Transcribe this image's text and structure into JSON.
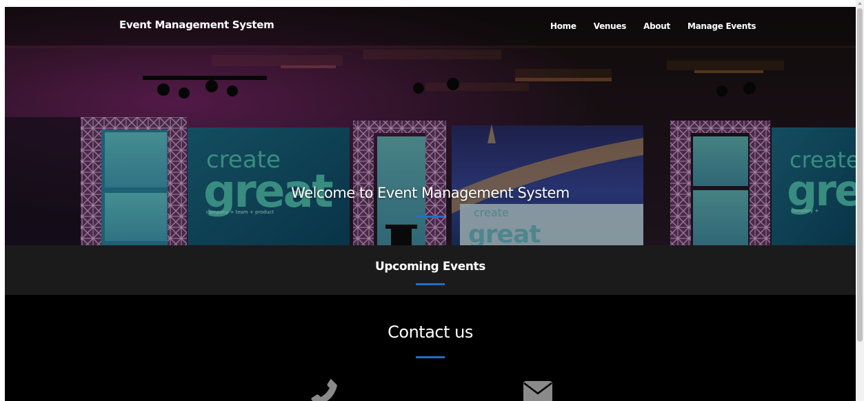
{
  "navbar": {
    "brand": "Event Management System",
    "links": [
      "Home",
      "Venues",
      "About",
      "Manage Events"
    ]
  },
  "hero": {
    "title": "Welcome to Event Management System",
    "background_text": {
      "left_small": "create",
      "left_big": "great",
      "left_tagline": "company + team + product",
      "center_small": "create",
      "center_big": "great",
      "right_small": "create",
      "right_big": "gre",
      "right_tagline": "company +"
    }
  },
  "upcoming": {
    "title": "Upcoming Events"
  },
  "contact": {
    "title": "Contact us",
    "icons": [
      "phone-icon",
      "envelope-icon"
    ]
  },
  "colors": {
    "accent": "#1f6fd0",
    "upcoming_bg": "#1b1b1b",
    "contact_bg": "#000000",
    "icon_gray": "#8a8a8a"
  }
}
